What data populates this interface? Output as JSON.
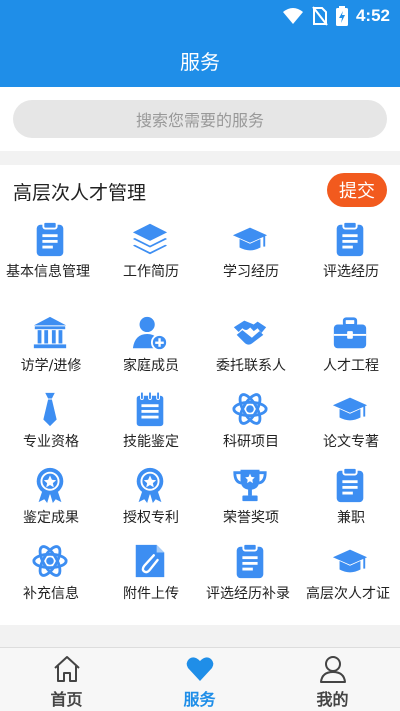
{
  "status_bar": {
    "time": "4:52"
  },
  "header": {
    "title": "服务"
  },
  "search": {
    "placeholder": "搜索您需要的服务"
  },
  "panel": {
    "title": "高层次人才管理",
    "submit_label": "提交",
    "items": [
      {
        "label": "基本信息管理",
        "icon": "clipboard-icon"
      },
      {
        "label": "工作简历",
        "icon": "layers-icon"
      },
      {
        "label": "学习经历",
        "icon": "graduation-cap-icon"
      },
      {
        "label": "评选经历",
        "icon": "clipboard-icon"
      },
      {
        "label": "访学/进修",
        "icon": "institution-icon"
      },
      {
        "label": "家庭成员",
        "icon": "add-user-icon"
      },
      {
        "label": "委托联系人",
        "icon": "handshake-icon"
      },
      {
        "label": "人才工程",
        "icon": "toolbox-icon"
      },
      {
        "label": "专业资格",
        "icon": "necktie-icon"
      },
      {
        "label": "技能鉴定",
        "icon": "notepad-icon"
      },
      {
        "label": "科研项目",
        "icon": "atom-icon"
      },
      {
        "label": "论文专著",
        "icon": "graduation-cap-icon"
      },
      {
        "label": "鉴定成果",
        "icon": "medal-icon"
      },
      {
        "label": "授权专利",
        "icon": "medal-icon"
      },
      {
        "label": "荣誉奖项",
        "icon": "trophy-icon"
      },
      {
        "label": "兼职",
        "icon": "clipboard-icon"
      },
      {
        "label": "补充信息",
        "icon": "atom-icon"
      },
      {
        "label": "附件上传",
        "icon": "paperclip-file-icon"
      },
      {
        "label": "评选经历补录",
        "icon": "clipboard-icon"
      },
      {
        "label": "高层次人才证",
        "icon": "graduation-cap-icon"
      }
    ]
  },
  "bottom_nav": [
    {
      "label": "首页",
      "icon": "home-icon",
      "active": false
    },
    {
      "label": "服务",
      "icon": "heart-icon",
      "active": true
    },
    {
      "label": "我的",
      "icon": "user-icon",
      "active": false
    }
  ],
  "colors": {
    "primary": "#1f8ee8",
    "accent": "#f25a1e",
    "icon_blue": "#3d8ef2"
  }
}
